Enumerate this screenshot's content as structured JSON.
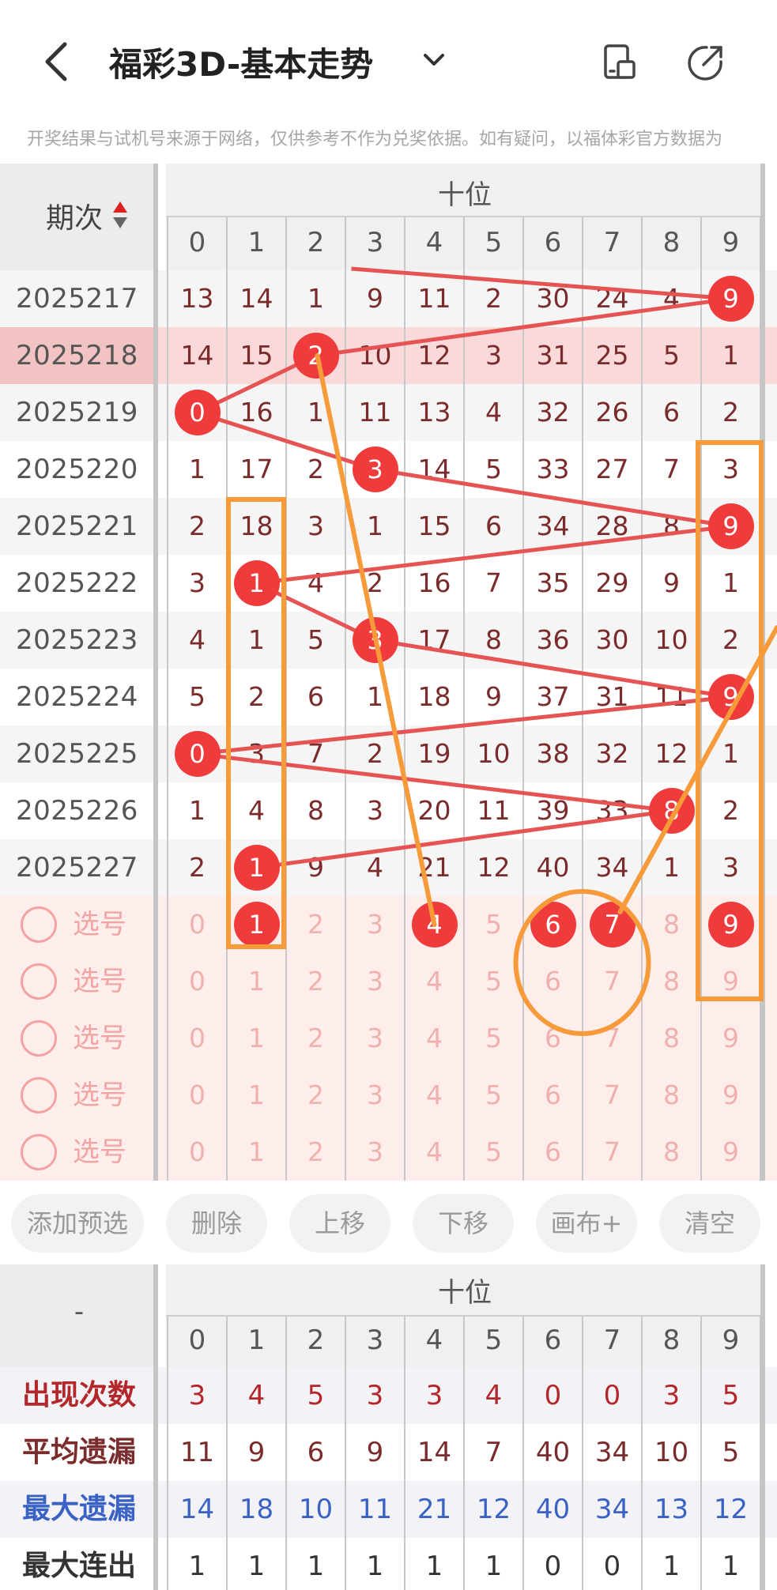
{
  "header": {
    "title": "福彩3D-基本走势",
    "back_icon": "chevron-left-icon",
    "dropdown_icon": "chevron-down-icon",
    "layout_icon": "layout-icon",
    "share_icon": "share-icon"
  },
  "disclaimer": "开奖结果与试机号来源于网络，仅供参考不作为兑奖依据。如有疑问，以福体彩官方数据为",
  "table": {
    "period_header": "期次",
    "sort_icon": "sort-icon",
    "section_title": "十位",
    "columns": [
      "0",
      "1",
      "2",
      "3",
      "4",
      "5",
      "6",
      "7",
      "8",
      "9"
    ],
    "rows": [
      {
        "period": "2025217",
        "cells": [
          "13",
          "14",
          "1",
          "9",
          "11",
          "2",
          "30",
          "24",
          "4",
          "9"
        ],
        "hit": 9
      },
      {
        "period": "2025218",
        "cells": [
          "14",
          "15",
          "2",
          "10",
          "12",
          "3",
          "31",
          "25",
          "5",
          "1"
        ],
        "hit": 2
      },
      {
        "period": "2025219",
        "cells": [
          "0",
          "16",
          "1",
          "11",
          "13",
          "4",
          "32",
          "26",
          "6",
          "2"
        ],
        "hit": 0
      },
      {
        "period": "2025220",
        "cells": [
          "1",
          "17",
          "2",
          "3",
          "14",
          "5",
          "33",
          "27",
          "7",
          "3"
        ],
        "hit": 3
      },
      {
        "period": "2025221",
        "cells": [
          "2",
          "18",
          "3",
          "1",
          "15",
          "6",
          "34",
          "28",
          "8",
          "9"
        ],
        "hit": 9
      },
      {
        "period": "2025222",
        "cells": [
          "3",
          "1",
          "4",
          "2",
          "16",
          "7",
          "35",
          "29",
          "9",
          "1"
        ],
        "hit": 1
      },
      {
        "period": "2025223",
        "cells": [
          "4",
          "1",
          "5",
          "3",
          "17",
          "8",
          "36",
          "30",
          "10",
          "2"
        ],
        "hit": 3
      },
      {
        "period": "2025224",
        "cells": [
          "5",
          "2",
          "6",
          "1",
          "18",
          "9",
          "37",
          "31",
          "11",
          "9"
        ],
        "hit": 9
      },
      {
        "period": "2025225",
        "cells": [
          "0",
          "3",
          "7",
          "2",
          "19",
          "10",
          "38",
          "32",
          "12",
          "1"
        ],
        "hit": 0
      },
      {
        "period": "2025226",
        "cells": [
          "1",
          "4",
          "8",
          "3",
          "20",
          "11",
          "39",
          "33",
          "8",
          "2"
        ],
        "hit": 8
      },
      {
        "period": "2025227",
        "cells": [
          "2",
          "1",
          "9",
          "4",
          "21",
          "12",
          "40",
          "34",
          "1",
          "3"
        ],
        "hit": 1
      }
    ],
    "pick_label": "选号",
    "pick_rows": [
      {
        "cells": [
          "0",
          "1",
          "2",
          "3",
          "4",
          "5",
          "6",
          "7",
          "8",
          "9"
        ],
        "selected": [
          1,
          4,
          6,
          7,
          9
        ]
      },
      {
        "cells": [
          "0",
          "1",
          "2",
          "3",
          "4",
          "5",
          "6",
          "7",
          "8",
          "9"
        ],
        "selected": []
      },
      {
        "cells": [
          "0",
          "1",
          "2",
          "3",
          "4",
          "5",
          "6",
          "7",
          "8",
          "9"
        ],
        "selected": []
      },
      {
        "cells": [
          "0",
          "1",
          "2",
          "3",
          "4",
          "5",
          "6",
          "7",
          "8",
          "9"
        ],
        "selected": []
      },
      {
        "cells": [
          "0",
          "1",
          "2",
          "3",
          "4",
          "5",
          "6",
          "7",
          "8",
          "9"
        ],
        "selected": []
      }
    ]
  },
  "buttons": [
    "添加预选",
    "删除",
    "上移",
    "下移",
    "画布+",
    "清空"
  ],
  "stats": {
    "corner": "-",
    "section_title": "十位",
    "columns": [
      "0",
      "1",
      "2",
      "3",
      "4",
      "5",
      "6",
      "7",
      "8",
      "9"
    ],
    "rows": [
      {
        "label": "出现次数",
        "values": [
          "3",
          "4",
          "5",
          "3",
          "3",
          "4",
          "0",
          "0",
          "3",
          "5"
        ],
        "color": "#b3262a"
      },
      {
        "label": "平均遗漏",
        "values": [
          "11",
          "9",
          "6",
          "9",
          "14",
          "7",
          "40",
          "34",
          "10",
          "5"
        ],
        "color": "#7a2b2b"
      },
      {
        "label": "最大遗漏",
        "values": [
          "14",
          "18",
          "10",
          "11",
          "21",
          "12",
          "40",
          "34",
          "13",
          "12"
        ],
        "color": "#3a62c4"
      },
      {
        "label": "最大连出",
        "values": [
          "1",
          "1",
          "1",
          "1",
          "1",
          "1",
          "0",
          "0",
          "1",
          "1"
        ],
        "color": "#333333"
      }
    ]
  },
  "colors": {
    "ball": "#ef3b3b",
    "line": "#e55353",
    "annotation": "#f79a3a",
    "highlight_row": "#f9d9d9",
    "pick_bg": "#fdeeec"
  }
}
